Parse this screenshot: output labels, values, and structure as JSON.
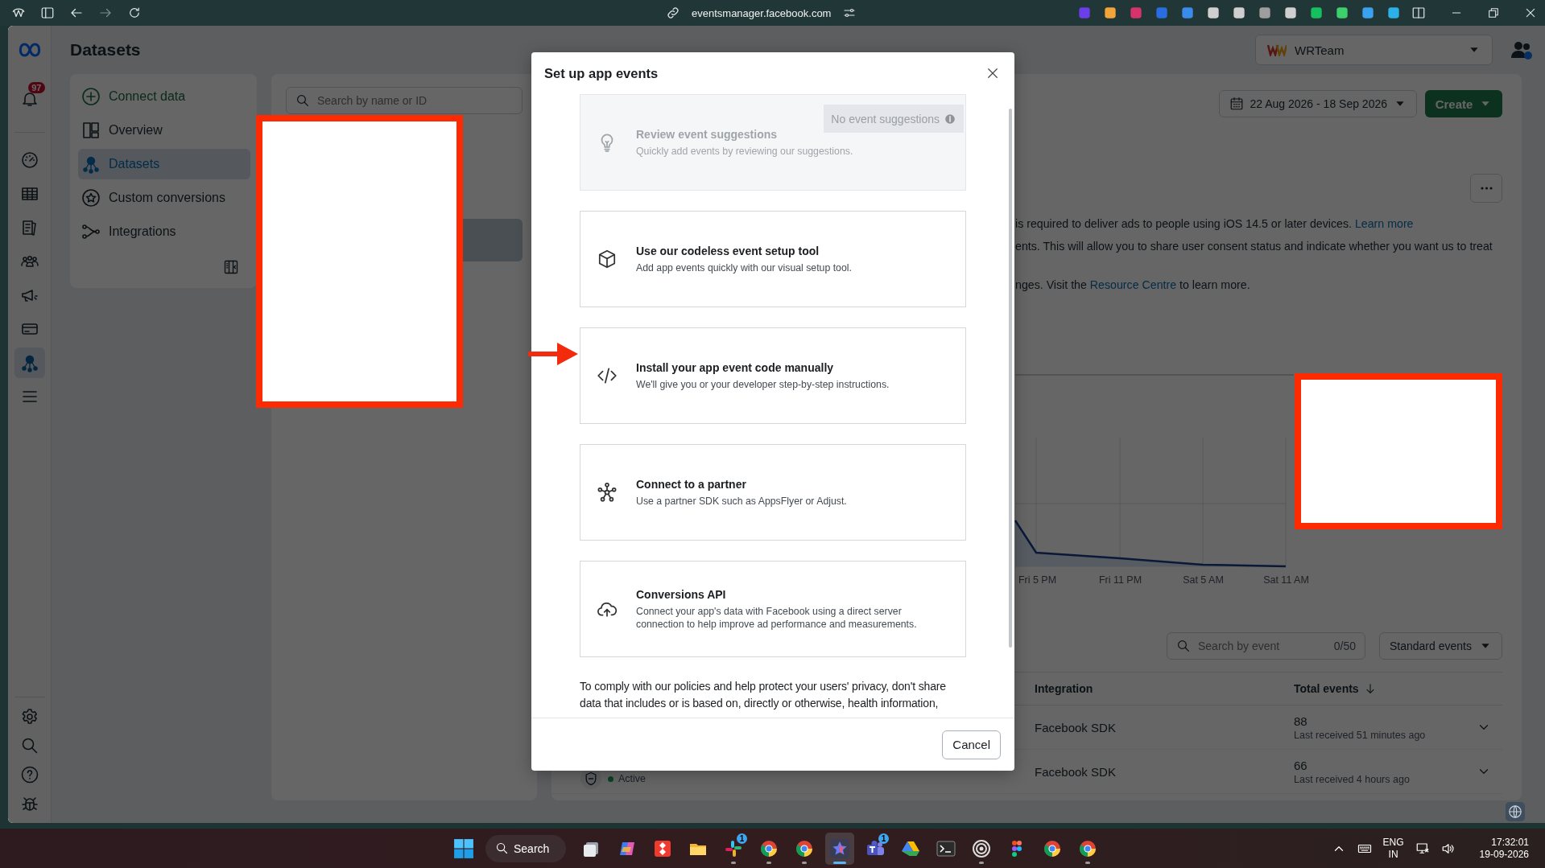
{
  "browser": {
    "url": "eventsmanager.facebook.com"
  },
  "rail": {
    "notification_count": "97",
    "items": [
      {
        "kind": "gauge",
        "selected": false
      },
      {
        "kind": "table",
        "selected": false
      },
      {
        "kind": "pages",
        "selected": false
      },
      {
        "kind": "people",
        "selected": false
      },
      {
        "kind": "megaphone",
        "selected": false
      },
      {
        "kind": "card",
        "selected": false
      },
      {
        "kind": "datasets",
        "selected": true
      },
      {
        "kind": "menu",
        "selected": false
      }
    ],
    "bottom_items": [
      {
        "kind": "gear"
      },
      {
        "kind": "search"
      },
      {
        "kind": "help"
      },
      {
        "kind": "bug"
      }
    ]
  },
  "header": {
    "title": "Datasets",
    "account": "WRTeam"
  },
  "nav": {
    "items": [
      {
        "kind": "add",
        "label": "Connect data",
        "selected": false
      },
      {
        "kind": "overview",
        "label": "Overview",
        "selected": false
      },
      {
        "kind": "datasets",
        "label": "Datasets",
        "selected": true
      },
      {
        "kind": "star",
        "label": "Custom conversions",
        "selected": false
      },
      {
        "kind": "integrations",
        "label": "Integrations",
        "selected": false
      }
    ]
  },
  "datasets_list": {
    "search_placeholder": "Search by name or ID",
    "rows": [
      {
        "selected": true
      }
    ]
  },
  "overview": {
    "date_range": "22 Aug 2026 - 18 Sep 2026",
    "create_button": "Create",
    "notices": [
      {
        "before": "is required to deliver ads to people using iOS 14.5 or later devices.",
        "link": "Learn more"
      },
      {
        "before": "ents. This will allow you to share user consent status and indicate whether you want us to treat"
      },
      {
        "before": "nges. Visit the",
        "link": "Resource Centre",
        "after": "to learn more."
      }
    ],
    "chart_x_labels": [
      "Fri 5 PM",
      "Fri 11 PM",
      "Sat 5 AM",
      "Sat 11 AM"
    ]
  },
  "events": {
    "search_placeholder": "Search by event",
    "count": "0/50",
    "filter": "Standard events",
    "columns": [
      {
        "label": "Integration",
        "sorted": false
      },
      {
        "label": "Total events",
        "sorted": true
      }
    ],
    "rows": [
      {
        "integration": "Facebook SDK",
        "total": "88",
        "last_received": "Last received 51 minutes ago"
      },
      {
        "status": "Active",
        "integration": "Facebook SDK",
        "total": "66",
        "last_received": "Last received 4 hours ago"
      }
    ]
  },
  "modal": {
    "title": "Set up app events",
    "options": [
      {
        "kind": "bulb",
        "title": "Review event suggestions",
        "description": "Quickly add events by reviewing our suggestions.",
        "disabled": true,
        "badge": "No event suggestions"
      },
      {
        "kind": "cube",
        "title": "Use our codeless event setup tool",
        "description": "Add app events quickly with our visual setup tool.",
        "disabled": false
      },
      {
        "kind": "code",
        "title": "Install your app event code manually",
        "description": "We'll give you or your developer step-by-step instructions.",
        "disabled": false
      },
      {
        "kind": "partner",
        "title": "Connect to a partner",
        "description": "Use a partner SDK such as AppsFlyer or Adjust.",
        "disabled": false
      },
      {
        "kind": "cloud",
        "title": "Conversions API",
        "description": "Connect your app's data with Facebook using a direct server connection to help improve ad performance and measurements.",
        "disabled": false
      }
    ],
    "notice": "To comply with our policies and help protect your users' privacy, don't share data that includes or is based on, directly or otherwise, health information,",
    "cancel": "Cancel"
  },
  "taskbar": {
    "search": "Search",
    "apps": [
      {
        "kind": "taskview",
        "selected": false,
        "running": false
      },
      {
        "kind": "copilot",
        "selected": false,
        "running": false
      },
      {
        "kind": "remote",
        "selected": false,
        "running": false
      },
      {
        "kind": "folder",
        "selected": false,
        "running": false
      },
      {
        "kind": "slack",
        "selected": false,
        "running": true,
        "badge": "1"
      },
      {
        "kind": "chrome",
        "selected": false,
        "running": true
      },
      {
        "kind": "chrome",
        "selected": false,
        "running": true
      },
      {
        "kind": "star",
        "selected": true,
        "running": true
      },
      {
        "kind": "teams",
        "selected": false,
        "running": false,
        "badge": "1"
      },
      {
        "kind": "drive",
        "selected": false,
        "running": false
      },
      {
        "kind": "terminal",
        "selected": false,
        "running": false
      },
      {
        "kind": "ring",
        "selected": false,
        "running": true
      },
      {
        "kind": "figma",
        "selected": false,
        "running": false
      },
      {
        "kind": "chrome",
        "selected": false,
        "running": false
      },
      {
        "kind": "chrome",
        "selected": false,
        "running": true
      }
    ],
    "tray": {
      "language": "ENG",
      "region": "IN",
      "time": "17:32:01",
      "date": "19-09-2026"
    }
  }
}
